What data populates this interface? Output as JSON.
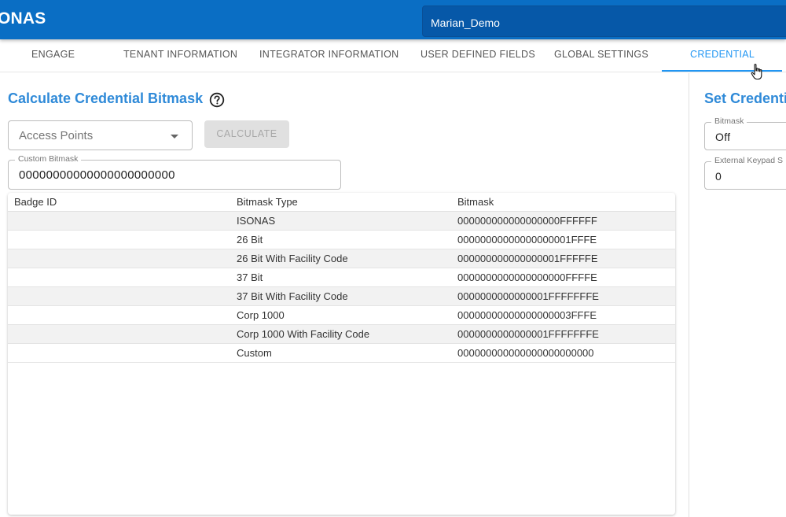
{
  "app": {
    "title": "ONAS"
  },
  "tenant": {
    "value": "Marian_Demo"
  },
  "tabs": [
    {
      "label": "ENGAGE"
    },
    {
      "label": "TENANT INFORMATION"
    },
    {
      "label": "INTEGRATOR INFORMATION"
    },
    {
      "label": "USER DEFINED FIELDS"
    },
    {
      "label": "GLOBAL SETTINGS"
    },
    {
      "label": "CREDENTIAL",
      "active": true
    }
  ],
  "calculate": {
    "title": "Calculate Credential Bitmask",
    "help_icon": "help-circle-icon",
    "access_points_placeholder": "Access Points",
    "calculate_button": "CALCULATE",
    "custom_bitmask_label": "Custom Bitmask",
    "custom_bitmask_value": "00000000000000000000000"
  },
  "table": {
    "headers": [
      "Badge ID",
      "Bitmask Type",
      "Bitmask"
    ],
    "rows": [
      {
        "badge_id": "",
        "type": "ISONAS",
        "bitmask": "000000000000000000FFFFFF"
      },
      {
        "badge_id": "",
        "type": "26 Bit",
        "bitmask": "00000000000000000001FFFE"
      },
      {
        "badge_id": "",
        "type": "26 Bit With Facility Code",
        "bitmask": "000000000000000001FFFFFE"
      },
      {
        "badge_id": "",
        "type": "37 Bit",
        "bitmask": "0000000000000000000FFFFE"
      },
      {
        "badge_id": "",
        "type": "37 Bit With Facility Code",
        "bitmask": "0000000000000001FFFFFFFE"
      },
      {
        "badge_id": "",
        "type": "Corp 1000",
        "bitmask": "00000000000000000003FFFE"
      },
      {
        "badge_id": "",
        "type": "Corp 1000 With Facility Code",
        "bitmask": "0000000000000001FFFFFFFE"
      },
      {
        "badge_id": "",
        "type": "Custom",
        "bitmask": "000000000000000000000000"
      }
    ]
  },
  "set_credential": {
    "title": "Set Credenti",
    "bitmask_label": "Bitmask",
    "bitmask_value": "Off",
    "keypad_label": "External Keypad S",
    "keypad_value": "0"
  },
  "colors": {
    "appbar": "#0a6ec4",
    "accent": "#2196f3",
    "title": "#2f8ad8"
  }
}
